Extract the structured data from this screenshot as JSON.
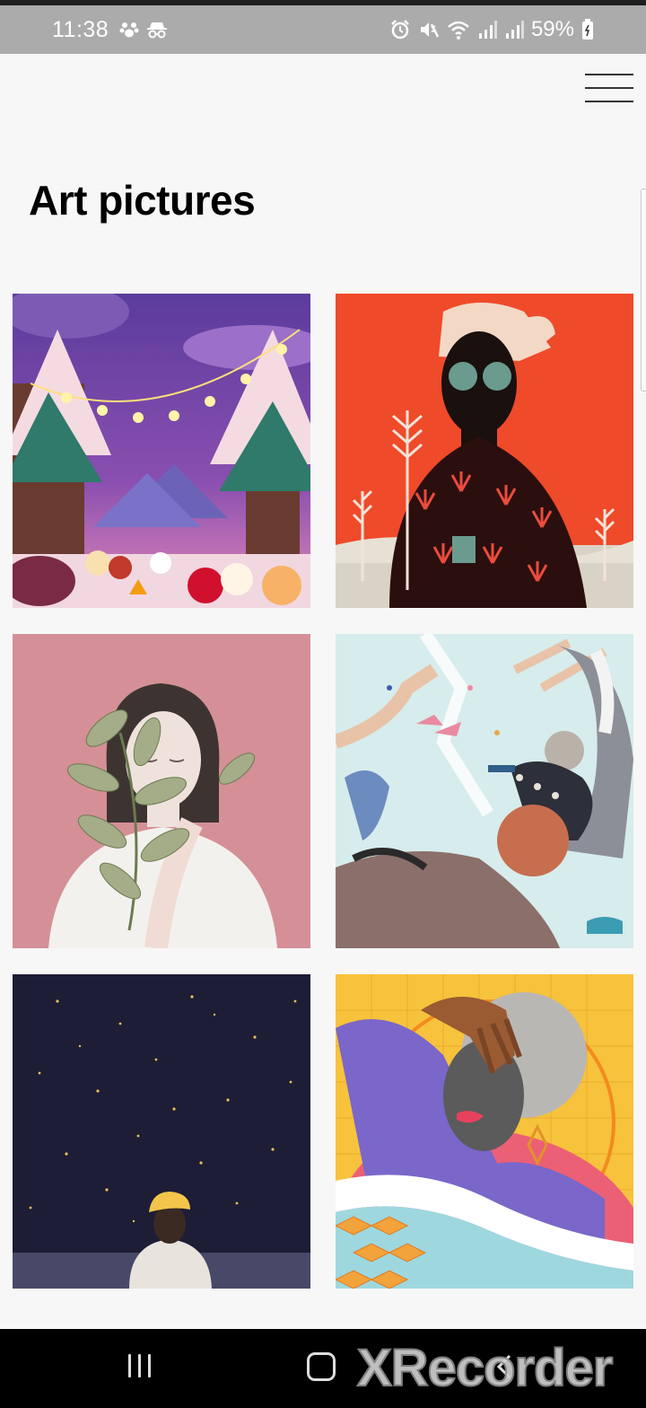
{
  "status_bar": {
    "time": "11:38",
    "battery": "59%",
    "left_icons": [
      "paw-icon",
      "incognito-icon"
    ],
    "right_icons": [
      "alarm-icon",
      "mute-icon",
      "wifi-icon",
      "signal-icon",
      "signal-icon",
      "battery-icon"
    ]
  },
  "header": {
    "menu_icon": "hamburger-menu-icon",
    "title": "Art pictures"
  },
  "gallery": {
    "items": [
      {
        "subject": "winter-forest-festival-illustration"
      },
      {
        "subject": "woman-with-sunglasses-red-background-illustration"
      },
      {
        "subject": "woman-with-leaves-pink-background-illustration"
      },
      {
        "subject": "surreal-birds-and-grandmother-illustration"
      },
      {
        "subject": "starry-night-boy-yellow-cap-illustration"
      },
      {
        "subject": "pop-art-woman-portrait-collage"
      }
    ]
  },
  "nav_bar": {
    "recent_icon": "recent-apps-icon",
    "home_icon": "home-icon",
    "back_icon": "back-icon",
    "watermark": "XRecorder"
  },
  "colors": {
    "status_bar_bg": "#ababab",
    "page_bg": "#f7f7f7",
    "nav_bar_bg": "#000000"
  }
}
